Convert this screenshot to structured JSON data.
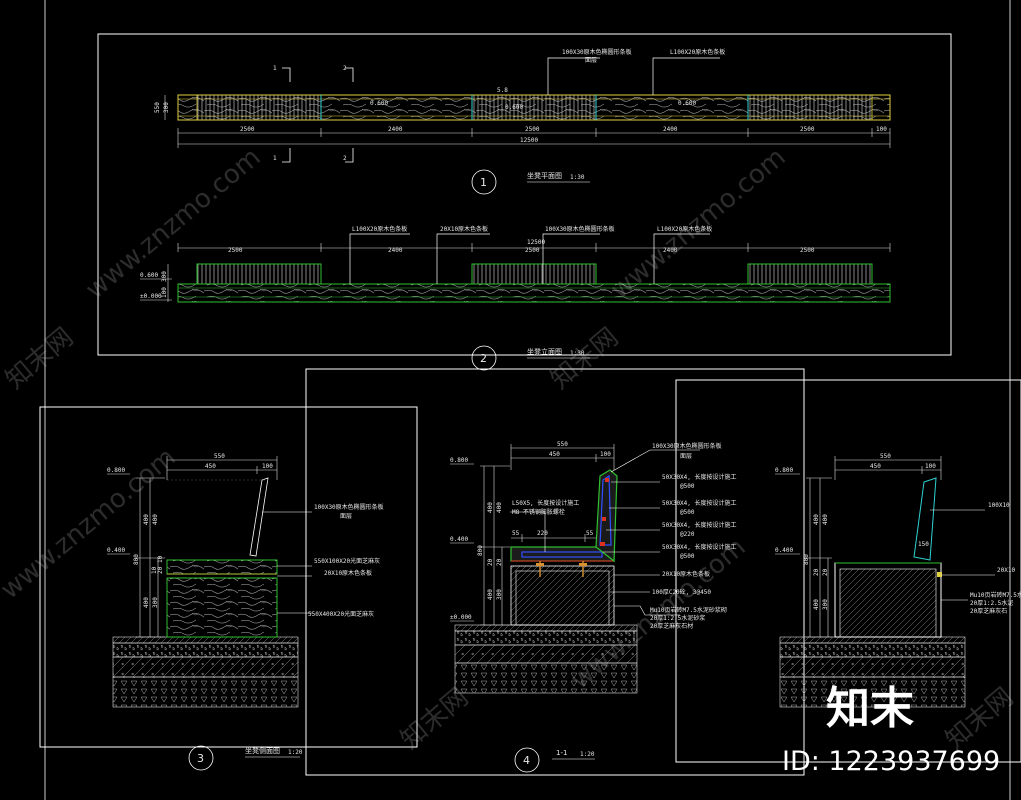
{
  "colors": {
    "background": "#000000",
    "frame": "#ffffff",
    "seat_outline": "#e0d040",
    "elevation_outline": "#30c030",
    "accent_cyan": "#30d0d0",
    "rebar": "#3050ff",
    "fill_red": "#e03020",
    "dims": "#dddddd"
  },
  "plan": {
    "section_markers": [
      "1",
      "2",
      "1",
      "2"
    ],
    "leader_top_left": "100X30原木色椭圆形条板",
    "leader_top_left_sub": "面层",
    "leader_top_right": "L100X20原木色条板",
    "elev_label": "0.600",
    "dims_vert": [
      "550",
      "300"
    ],
    "mid_labels": [
      "0.600",
      "0.600",
      "0.600"
    ],
    "top_mid": "5.8",
    "dims_bottom": [
      "2500",
      "2400",
      "2500",
      "2400",
      "2500",
      "100"
    ],
    "total": "12500",
    "number": "1",
    "title": "坐凳平面图",
    "scale": "1:30"
  },
  "elevation": {
    "leaders": [
      "L100X20原木色条板",
      "20X10原木色条板",
      "100X30原木色椭圆形条板",
      "L100X20原木色条板"
    ],
    "dims_top": [
      "2500",
      "2400",
      "2500",
      "2400",
      "2500"
    ],
    "total": "12500",
    "elev_labels": [
      "0.600",
      "±0.000"
    ],
    "dim_vert": [
      "300",
      "100"
    ],
    "number": "2",
    "title": "坐凳立面图",
    "scale": "1:30"
  },
  "detail3": {
    "elev_labels": [
      "0.800",
      "0.400"
    ],
    "dims_top": [
      "550",
      "450",
      "100"
    ],
    "dims_left": [
      "400",
      "400",
      "800",
      "10",
      "20",
      "10",
      "400",
      "300"
    ],
    "leaders": [
      "100X30原木色椭圆形条板",
      "面层",
      "550X100X20光面芝麻灰",
      "20X10原木色条板",
      "550X400X20光面芝麻灰"
    ],
    "number": "3",
    "title": "坐凳侧面图",
    "scale": "1:20"
  },
  "detail4": {
    "elev_labels": [
      "0.800",
      "0.400",
      "±0.000"
    ],
    "dims_top": [
      "550",
      "450",
      "100"
    ],
    "dims_left": [
      "400",
      "400",
      "800",
      "20",
      "20",
      "400",
      "300"
    ],
    "dims_seat": [
      "55",
      "220",
      "55"
    ],
    "leader_left": "L50X5, 长度按设计施工",
    "leader_left_sub": "M8 不锈钢膨胀螺栓",
    "leaders_right": [
      "100X30原木色椭圆形条板",
      "面层",
      "50X30X4, 长度按设计施工",
      "@500",
      "50X30X4, 长度按设计施工",
      "@500",
      "50X30X4, 长度按设计施工",
      "@220",
      "50X30X4, 长度按设计施工",
      "@500",
      "20X10原木色条板",
      "100厚C20砼, 3@450"
    ],
    "leader_bottom": [
      "Mu10页岩砖M7.5水泥砂浆砌",
      "20厚1:2.5水泥砂浆",
      "20厚芝麻灰石材"
    ],
    "number": "4",
    "title": "1-1",
    "scale": "1:20"
  },
  "detail5": {
    "elev_labels": [
      "0.800",
      "0.400"
    ],
    "dims_top": [
      "550",
      "450",
      "100"
    ],
    "dims_left": [
      "400",
      "400",
      "800",
      "20",
      "20",
      "400",
      "300"
    ],
    "dim_inner": "150",
    "leaders": [
      "100X10",
      "20X10",
      "Mu10页岩砖M7.5水",
      "20厚1:2.5水泥",
      "20厚芝麻灰石"
    ]
  },
  "watermark": {
    "diagonal": "www.znzmo.com",
    "cn": "知末网",
    "brand": "知末",
    "id": "ID: 1223937699"
  }
}
